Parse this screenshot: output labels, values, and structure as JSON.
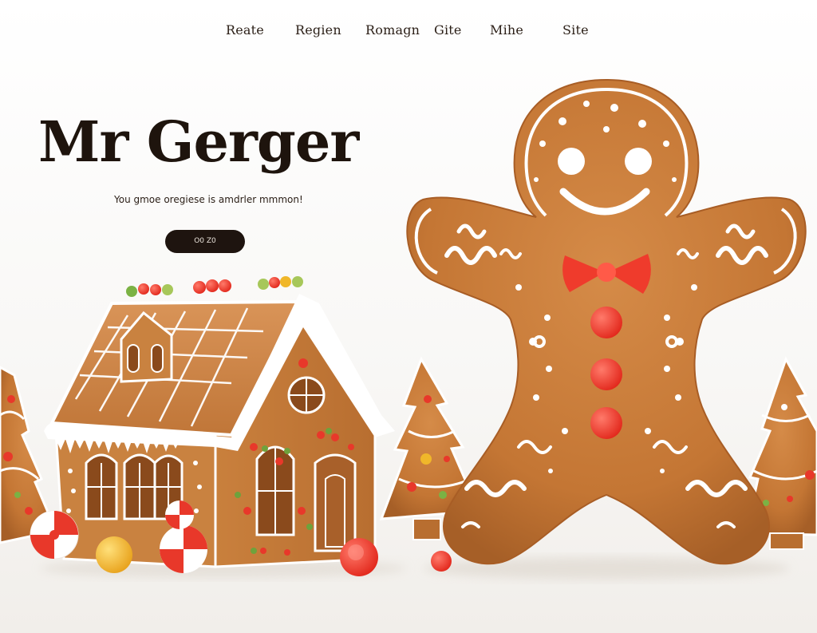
{
  "nav": {
    "items": [
      {
        "label": "Reate"
      },
      {
        "label": "Regien"
      },
      {
        "label": "Romagn"
      },
      {
        "label": "Gite"
      },
      {
        "label": "Mihe"
      },
      {
        "label": "Site"
      }
    ]
  },
  "hero": {
    "title": "Mr Gerger",
    "subtitle": "You gmoe oregiese is amdrler mmmon!",
    "cta_label": "O0 Z0"
  },
  "colors": {
    "gingerbread": "#c87a3a",
    "gingerbread_dark": "#a9602a",
    "icing": "#ffffff",
    "candy_red": "#e8382a",
    "button_dark": "#1e140f",
    "title": "#1e140d"
  }
}
